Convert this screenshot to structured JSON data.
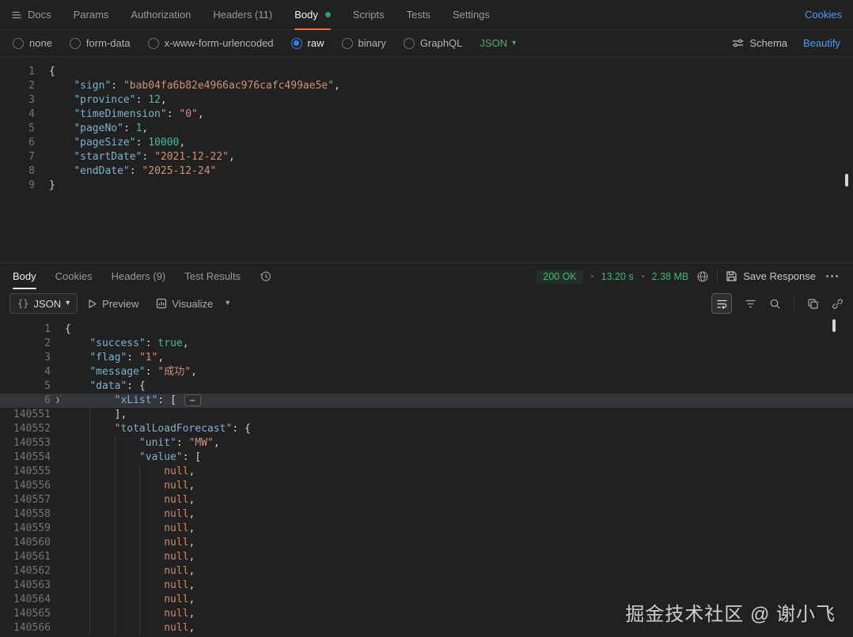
{
  "header": {
    "tabs": [
      {
        "label": "Docs"
      },
      {
        "label": "Params"
      },
      {
        "label": "Authorization"
      },
      {
        "label": "Headers (11)"
      },
      {
        "label": "Body",
        "active": true,
        "modified": true
      },
      {
        "label": "Scripts"
      },
      {
        "label": "Tests"
      },
      {
        "label": "Settings"
      }
    ],
    "cookies_link": "Cookies"
  },
  "body_bar": {
    "options": [
      {
        "label": "none"
      },
      {
        "label": "form-data"
      },
      {
        "label": "x-www-form-urlencoded"
      },
      {
        "label": "raw",
        "selected": true
      },
      {
        "label": "binary"
      },
      {
        "label": "GraphQL"
      }
    ],
    "language": "JSON",
    "schema_label": "Schema",
    "beautify_label": "Beautify"
  },
  "request_editor": {
    "lines": [
      {
        "num": "1",
        "indent": 0,
        "tokens": [
          [
            "p",
            "{"
          ]
        ]
      },
      {
        "num": "2",
        "indent": 4,
        "tokens": [
          [
            "k",
            "\"sign\""
          ],
          [
            "p",
            ": "
          ],
          [
            "s",
            "\"bab04fa6b82e4966ac976cafc499ae5e\""
          ],
          [
            "p",
            ","
          ]
        ]
      },
      {
        "num": "3",
        "indent": 4,
        "tokens": [
          [
            "k",
            "\"province\""
          ],
          [
            "p",
            ": "
          ],
          [
            "n",
            "12"
          ],
          [
            "p",
            ","
          ]
        ]
      },
      {
        "num": "4",
        "indent": 4,
        "tokens": [
          [
            "k",
            "\"timeDimension\""
          ],
          [
            "p",
            ": "
          ],
          [
            "s",
            "\"0\""
          ],
          [
            "p",
            ","
          ]
        ]
      },
      {
        "num": "5",
        "indent": 4,
        "tokens": [
          [
            "k",
            "\"pageNo\""
          ],
          [
            "p",
            ": "
          ],
          [
            "n",
            "1"
          ],
          [
            "p",
            ","
          ]
        ]
      },
      {
        "num": "6",
        "indent": 4,
        "tokens": [
          [
            "k",
            "\"pageSize\""
          ],
          [
            "p",
            ": "
          ],
          [
            "n",
            "10000"
          ],
          [
            "p",
            ","
          ]
        ]
      },
      {
        "num": "7",
        "indent": 4,
        "tokens": [
          [
            "k",
            "\"startDate\""
          ],
          [
            "p",
            ": "
          ],
          [
            "s",
            "\"2021-12-22\""
          ],
          [
            "p",
            ","
          ]
        ]
      },
      {
        "num": "8",
        "indent": 4,
        "tokens": [
          [
            "k",
            "\"endDate\""
          ],
          [
            "p",
            ": "
          ],
          [
            "s",
            "\"2025-12-24\""
          ]
        ]
      },
      {
        "num": "9",
        "indent": 0,
        "tokens": [
          [
            "p",
            "}"
          ]
        ]
      }
    ]
  },
  "response": {
    "tabs": [
      {
        "label": "Body",
        "active": true
      },
      {
        "label": "Cookies"
      },
      {
        "label": "Headers (9)"
      },
      {
        "label": "Test Results"
      }
    ],
    "status": "200 OK",
    "time": "13.20 s",
    "size": "2.38 MB",
    "save_label": "Save Response"
  },
  "response_toolbar": {
    "format_icon": "{}",
    "format": "JSON",
    "preview": "Preview",
    "visualize": "Visualize"
  },
  "response_editor": {
    "lines": [
      {
        "num": "1",
        "indent": 0,
        "tokens": [
          [
            "p",
            "{"
          ]
        ]
      },
      {
        "num": "2",
        "indent": 4,
        "tokens": [
          [
            "k",
            "\"success\""
          ],
          [
            "p",
            ": "
          ],
          [
            "b",
            "true"
          ],
          [
            "p",
            ","
          ]
        ]
      },
      {
        "num": "3",
        "indent": 4,
        "tokens": [
          [
            "k",
            "\"flag\""
          ],
          [
            "p",
            ": "
          ],
          [
            "s",
            "\"1\""
          ],
          [
            "p",
            ","
          ]
        ]
      },
      {
        "num": "4",
        "indent": 4,
        "tokens": [
          [
            "k",
            "\"message\""
          ],
          [
            "p",
            ": "
          ],
          [
            "s",
            "\"成功\""
          ],
          [
            "p",
            ","
          ]
        ]
      },
      {
        "num": "5",
        "indent": 4,
        "tokens": [
          [
            "k",
            "\"data\""
          ],
          [
            "p",
            ": "
          ],
          [
            "p",
            "{"
          ]
        ]
      },
      {
        "num": "6",
        "indent": 8,
        "fold": true,
        "highlight": true,
        "collapsed": true,
        "tokens": [
          [
            "k",
            "\"xList\""
          ],
          [
            "p",
            ": "
          ],
          [
            "p",
            "["
          ]
        ]
      },
      {
        "num": "140551",
        "indent": 8,
        "tokens": [
          [
            "p",
            "],"
          ]
        ]
      },
      {
        "num": "140552",
        "indent": 8,
        "tokens": [
          [
            "k",
            "\"totalLoadForecast\""
          ],
          [
            "p",
            ": "
          ],
          [
            "p",
            "{"
          ]
        ]
      },
      {
        "num": "140553",
        "indent": 12,
        "tokens": [
          [
            "k",
            "\"unit\""
          ],
          [
            "p",
            ": "
          ],
          [
            "s",
            "\"MW\""
          ],
          [
            "p",
            ","
          ]
        ]
      },
      {
        "num": "140554",
        "indent": 12,
        "tokens": [
          [
            "k",
            "\"value\""
          ],
          [
            "p",
            ": "
          ],
          [
            "p",
            "["
          ]
        ]
      },
      {
        "num": "140555",
        "indent": 16,
        "tokens": [
          [
            "x",
            "null"
          ],
          [
            "p",
            ","
          ]
        ]
      },
      {
        "num": "140556",
        "indent": 16,
        "tokens": [
          [
            "x",
            "null"
          ],
          [
            "p",
            ","
          ]
        ]
      },
      {
        "num": "140557",
        "indent": 16,
        "tokens": [
          [
            "x",
            "null"
          ],
          [
            "p",
            ","
          ]
        ]
      },
      {
        "num": "140558",
        "indent": 16,
        "tokens": [
          [
            "x",
            "null"
          ],
          [
            "p",
            ","
          ]
        ]
      },
      {
        "num": "140559",
        "indent": 16,
        "tokens": [
          [
            "x",
            "null"
          ],
          [
            "p",
            ","
          ]
        ]
      },
      {
        "num": "140560",
        "indent": 16,
        "tokens": [
          [
            "x",
            "null"
          ],
          [
            "p",
            ","
          ]
        ]
      },
      {
        "num": "140561",
        "indent": 16,
        "tokens": [
          [
            "x",
            "null"
          ],
          [
            "p",
            ","
          ]
        ]
      },
      {
        "num": "140562",
        "indent": 16,
        "tokens": [
          [
            "x",
            "null"
          ],
          [
            "p",
            ","
          ]
        ]
      },
      {
        "num": "140563",
        "indent": 16,
        "tokens": [
          [
            "x",
            "null"
          ],
          [
            "p",
            ","
          ]
        ]
      },
      {
        "num": "140564",
        "indent": 16,
        "tokens": [
          [
            "x",
            "null"
          ],
          [
            "p",
            ","
          ]
        ]
      },
      {
        "num": "140565",
        "indent": 16,
        "tokens": [
          [
            "x",
            "null"
          ],
          [
            "p",
            ","
          ]
        ]
      },
      {
        "num": "140566",
        "indent": 16,
        "tokens": [
          [
            "x",
            "null"
          ],
          [
            "p",
            ","
          ]
        ]
      }
    ]
  },
  "icons": {
    "fold_arrow": "❯",
    "ellipsis": "⋯",
    "caret": "▾"
  },
  "watermark": "掘金技术社区 @ 谢小飞",
  "colors": {
    "accent": "#ff6c37",
    "link": "#4f9cf0",
    "success_green": "#3dba74",
    "lang_green": "#5aaa6a",
    "radio_blue": "#2f80ed"
  }
}
